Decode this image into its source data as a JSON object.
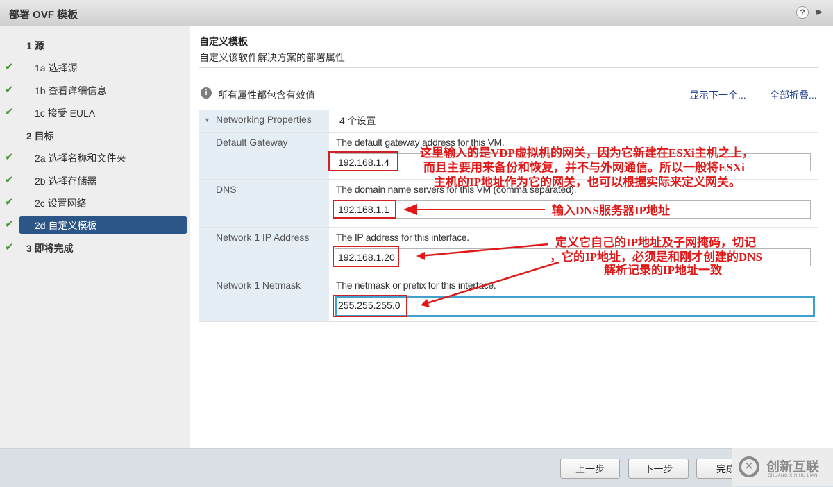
{
  "window": {
    "title": "部署 OVF 模板",
    "help_icon": "?",
    "expand_icon": "▸▸"
  },
  "sidebar": {
    "steps": [
      {
        "label": "1  源",
        "type": "section",
        "completed": false
      },
      {
        "label": "1a  选择源",
        "type": "sub",
        "completed": true
      },
      {
        "label": "1b  查看详细信息",
        "type": "sub",
        "completed": true
      },
      {
        "label": "1c  接受 EULA",
        "type": "sub",
        "completed": true
      },
      {
        "label": "2  目标",
        "type": "section",
        "completed": false
      },
      {
        "label": "2a  选择名称和文件夹",
        "type": "sub",
        "completed": true
      },
      {
        "label": "2b  选择存储器",
        "type": "sub",
        "completed": true
      },
      {
        "label": "2c  设置网络",
        "type": "sub",
        "completed": true
      },
      {
        "label": "2d  自定义模板",
        "type": "sub",
        "completed": true,
        "active": true
      },
      {
        "label": "3  即将完成",
        "type": "section",
        "completed": true
      }
    ],
    "check_glyph": "✔"
  },
  "main": {
    "title": "自定义模板",
    "subtitle": "自定义该软件解决方案的部署属性",
    "info_icon": "i",
    "info_text": "所有属性都包含有效值",
    "show_next_link": "显示下一个...",
    "collapse_all_link": "全部折叠...",
    "group": {
      "toggle_icon": "▼",
      "name": "Networking Properties",
      "summary": "4 个设置"
    },
    "properties": [
      {
        "name": "Default Gateway",
        "description": "The default gateway address for this VM.",
        "value": "192.168.1.4"
      },
      {
        "name": "DNS",
        "description": "The domain name servers for this VM (comma separated).",
        "value": "192.168.1.1"
      },
      {
        "name": "Network 1 IP Address",
        "description": "The IP address for this interface.",
        "value": "192.168.1.20"
      },
      {
        "name": "Network 1 Netmask",
        "description": "The netmask or prefix for this interface.",
        "value": "255.255.255.0"
      }
    ]
  },
  "annotations": {
    "gateway_note": [
      "这里输入的是VDP虚拟机的网关，因为它新建在ESXi主机之上，",
      "而且主要用来备份和恢复，并不与外网通信。所以一般将ESXi",
      "主机的IP地址作为它的网关，也可以根据实际来定义网关。"
    ],
    "dns_note": "输入DNS服务器IP地址",
    "ip_note": [
      "定义它自己的IP地址及子网掩码，切记",
      "，它的IP地址，必须是和刚才创建的DNS",
      "解析记录的IP地址一致"
    ],
    "color": "#e01818"
  },
  "footer": {
    "back_label": "上一步",
    "next_label": "下一步",
    "finish_label": "完成"
  },
  "watermark": {
    "logo_glyph": "✕",
    "text": "创新互联",
    "subtext": "CHUANG XIN HU LIAN"
  }
}
